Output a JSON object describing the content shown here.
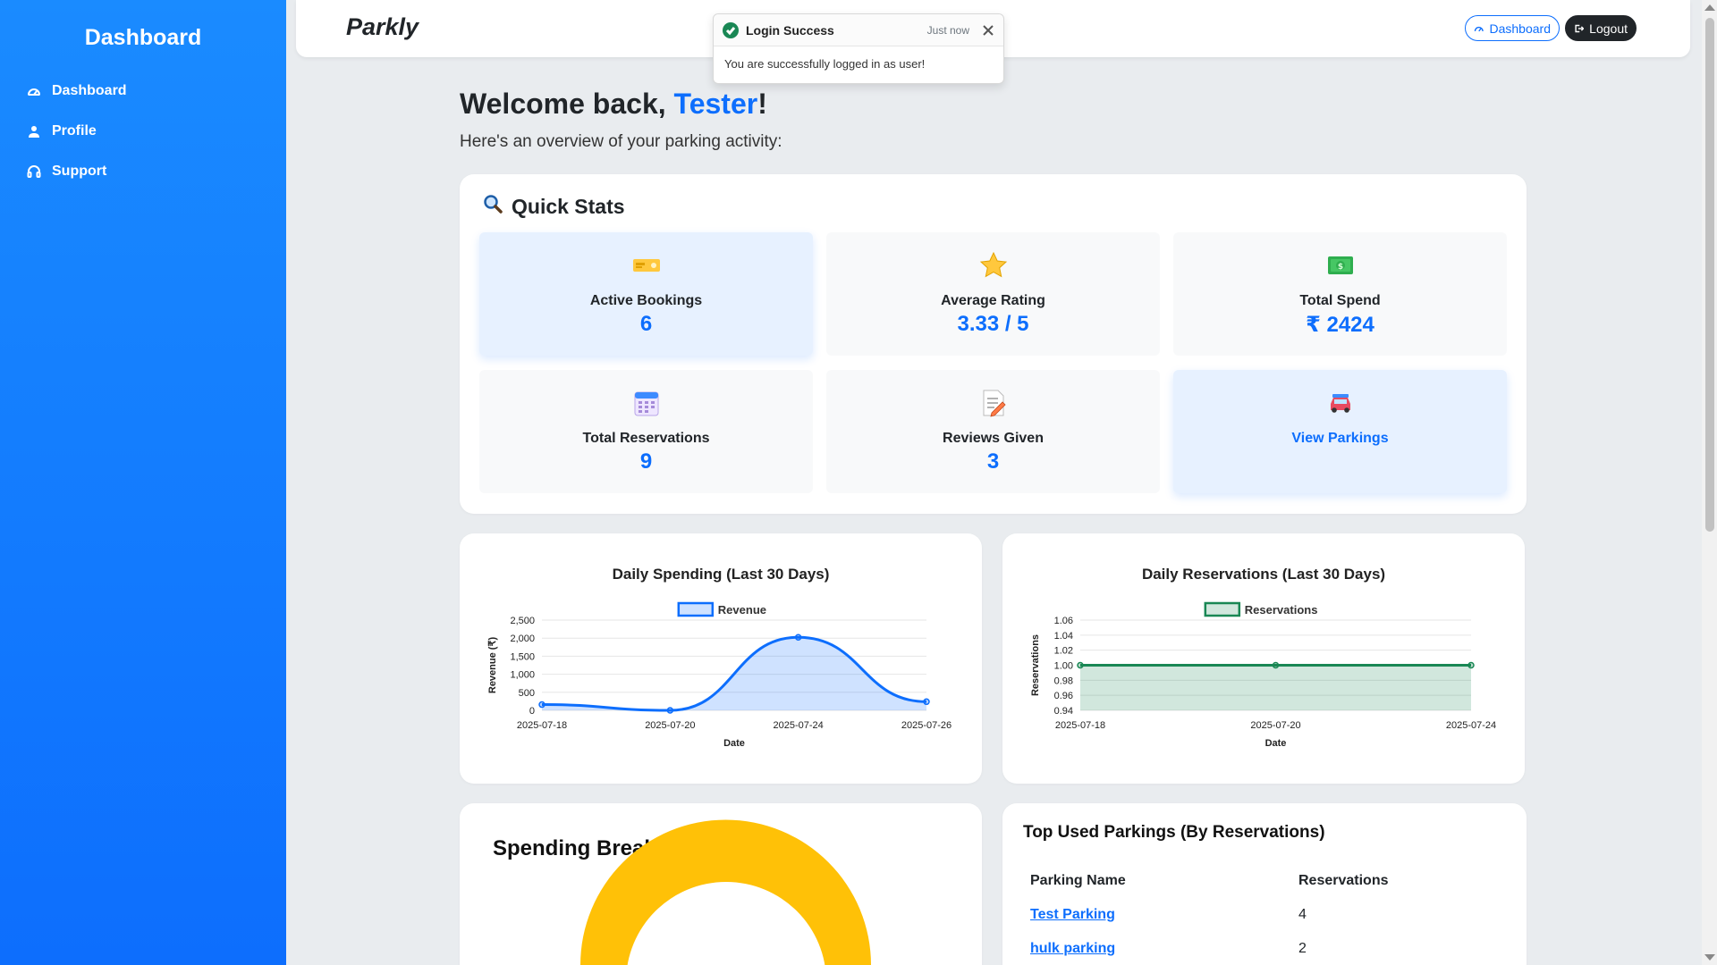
{
  "sidebar": {
    "title": "Dashboard",
    "items": [
      {
        "label": "Dashboard",
        "icon": "gauge-icon"
      },
      {
        "label": "Profile",
        "icon": "person-icon"
      },
      {
        "label": "Support",
        "icon": "headset-icon"
      }
    ]
  },
  "topbar": {
    "brand": "Parkly",
    "dashboard_btn": "Dashboard",
    "logout_btn": "Logout"
  },
  "toast": {
    "title": "Login Success",
    "time": "Just now",
    "message": "You are successfully logged in as user!"
  },
  "welcome": {
    "prefix": "Welcome back, ",
    "name": "Tester",
    "suffix": "!",
    "subtitle": "Here's an overview of your parking activity:"
  },
  "quick_stats": {
    "title": "Quick Stats",
    "icon": "magnifier-icon",
    "items": [
      {
        "label": "Active Bookings",
        "value": "6",
        "icon": "ticket-icon"
      },
      {
        "label": "Average Rating",
        "value": "3.33 / 5",
        "icon": "star-icon"
      },
      {
        "label": "Total Spend",
        "value": "₹ 2424",
        "icon": "money-icon"
      },
      {
        "label": "Total Reservations",
        "value": "9",
        "icon": "calendar-icon"
      },
      {
        "label": "Reviews Given",
        "value": "3",
        "icon": "memo-icon"
      },
      {
        "label": "View Parkings",
        "icon": "car-icon"
      }
    ]
  },
  "colors": {
    "primary": "#0d6efd",
    "sidebar": "#1a8bff",
    "success": "#198754",
    "donut_yellow": "#ffc107"
  },
  "chart_data": [
    {
      "type": "area",
      "title": "Daily Spending (Last 30 Days)",
      "legend": "Revenue",
      "legend_position": "top",
      "xlabel": "Date",
      "ylabel": "Revenue (₹)",
      "x": [
        "2025-07-18",
        "2025-07-20",
        "2025-07-24",
        "2025-07-26"
      ],
      "series": [
        {
          "name": "Revenue",
          "values": [
            160,
            0,
            2024,
            240
          ]
        }
      ],
      "yticks": [
        "0",
        "500",
        "1,000",
        "1,500",
        "2,000",
        "2,500"
      ],
      "ylim": [
        0,
        2500
      ],
      "color": "#0d6efd"
    },
    {
      "type": "area",
      "title": "Daily Reservations (Last 30 Days)",
      "legend": "Reservations",
      "legend_position": "top",
      "xlabel": "Date",
      "ylabel": "Reservations",
      "x": [
        "2025-07-18",
        "2025-07-20",
        "2025-07-24"
      ],
      "series": [
        {
          "name": "Reservations",
          "values": [
            1,
            1,
            1
          ]
        }
      ],
      "yticks": [
        "0.94",
        "0.96",
        "0.98",
        "1.00",
        "1.02",
        "1.04",
        "1.06"
      ],
      "ylim": [
        0.94,
        1.06
      ],
      "color": "#198754"
    }
  ],
  "spending_breakdown": {
    "title": "Spending Breakdown"
  },
  "top_parkings": {
    "title": "Top Used Parkings (By Reservations)",
    "headers": [
      "Parking Name",
      "Reservations"
    ],
    "rows": [
      {
        "name": "Test Parking",
        "count": "4"
      },
      {
        "name": "hulk parking",
        "count": "2"
      }
    ]
  }
}
